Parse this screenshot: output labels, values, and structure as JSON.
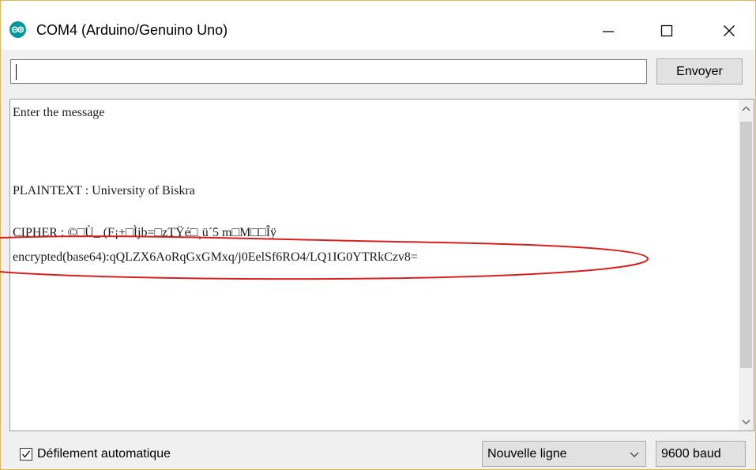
{
  "window": {
    "title": "COM4 (Arduino/Genuino Uno)",
    "app_icon": "arduino-icon",
    "controls": {
      "minimize": "minimize-icon",
      "maximize": "maximize-icon",
      "close": "close-icon"
    }
  },
  "input": {
    "value": "",
    "send_label": "Envoyer"
  },
  "output": {
    "lines": [
      "Enter the message",
      "",
      "",
      "PLAINTEXT : University of Biskra",
      "",
      "CIPHER : ©□Ù_ (F¡±□Ìjb=□zTŸé□¸ü´5 m□M□□Îÿ",
      "encrypted(base64):qQLZX6AoRqGxGMxq/j0EelSf6RO4/LQ1IG0YTRkCzv8="
    ]
  },
  "status": {
    "autoscroll_label": "Défilement automatique",
    "autoscroll_checked": true,
    "line_ending": "Nouvelle ligne",
    "baud_rate": "9600 baud"
  },
  "colors": {
    "window_border": "#e8b25a",
    "annotation": "#d62020",
    "arduino_teal": "#00979d"
  }
}
